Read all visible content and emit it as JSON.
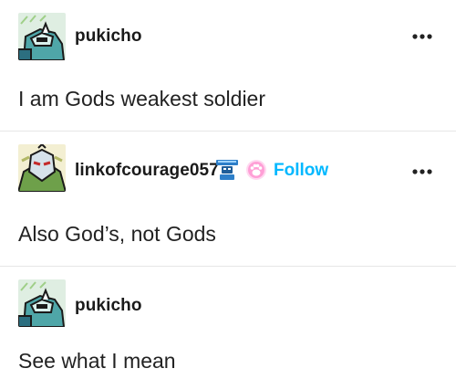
{
  "posts": [
    {
      "username": "pukicho",
      "text": "I am Gods weakest soldier",
      "avatar_icon": "robot-avatar-teal"
    },
    {
      "username": "linkofcourage057",
      "text": "Also God’s, not Gods",
      "follow_label": "Follow",
      "avatar_icon": "robot-avatar-green",
      "badges": [
        "robot-badge-icon",
        "paw-badge-icon"
      ]
    },
    {
      "username": "pukicho",
      "text": "See what I mean",
      "avatar_icon": "robot-avatar-teal"
    }
  ],
  "colors": {
    "follow": "#00b8ff",
    "divider": "#e6e6e6",
    "text": "#1a1a1a"
  }
}
